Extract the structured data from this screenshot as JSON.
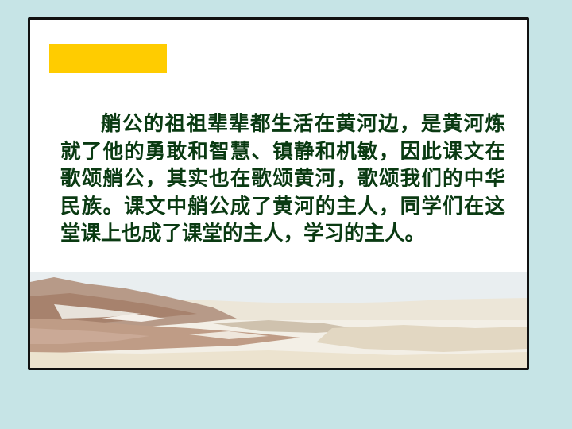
{
  "slide": {
    "paragraph": "艄公的祖祖辈辈都生活在黄河边，是黄河炼就了他的勇敢和智慧、镇静和机敏，因此课文在歌颂艄公，其实也在歌颂黄河，歌颂我们的中华民族。课文中艄公成了黄河的主人，同学们在这堂课上也成了课堂的主人，学习的主人。"
  },
  "colors": {
    "background": "#c6e4e6",
    "frame_border": "#111111",
    "slide_background": "#ffffff",
    "accent_bar": "#ffcc00",
    "text": "#0a3a12"
  }
}
